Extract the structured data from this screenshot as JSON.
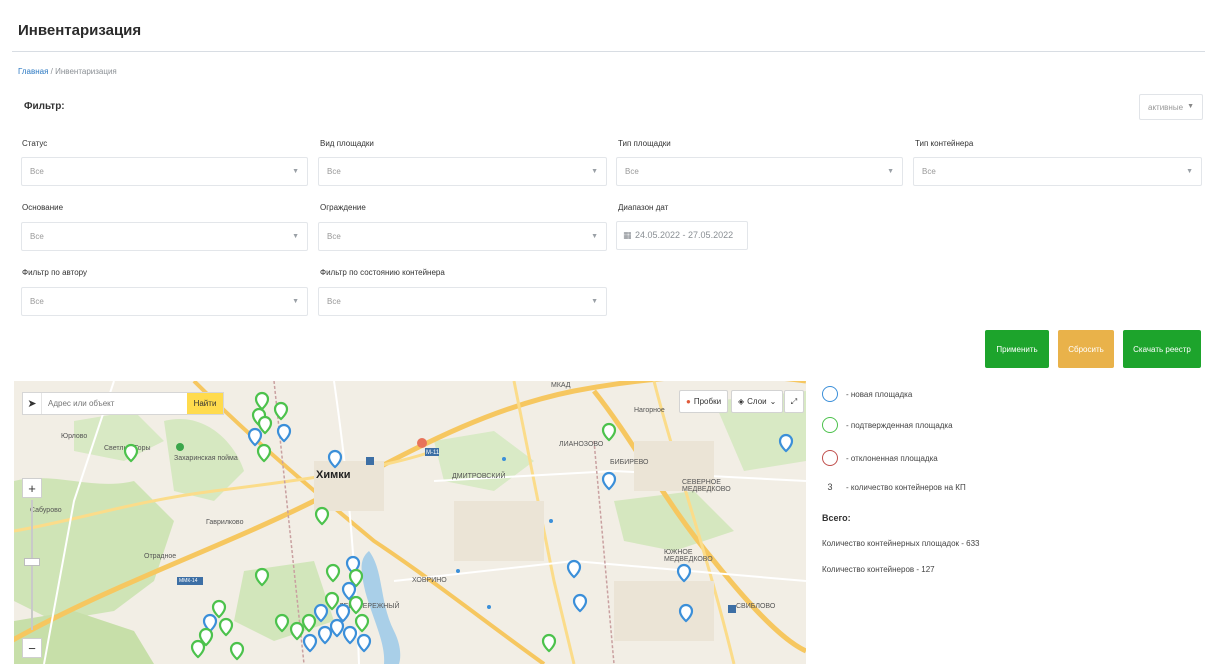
{
  "page": {
    "title": "Инвентаризация",
    "breadcrumb": {
      "home": "Главная",
      "separator": " / ",
      "current": "Инвентаризация"
    }
  },
  "filter": {
    "title": "Фильтр:",
    "active_select": "активные",
    "fields": {
      "status": {
        "label": "Статус",
        "value": "Все"
      },
      "site_kind": {
        "label": "Вид площадки",
        "value": "Все"
      },
      "site_type": {
        "label": "Тип площадки",
        "value": "Все"
      },
      "container_type": {
        "label": "Тип контейнера",
        "value": "Все"
      },
      "base": {
        "label": "Основание",
        "value": "Все"
      },
      "fence": {
        "label": "Ограждение",
        "value": "Все"
      },
      "date_range": {
        "label": "Диапазон дат",
        "value": "24.05.2022 - 27.05.2022"
      },
      "author": {
        "label": "Фильтр по автору",
        "value": "Все"
      },
      "container_state": {
        "label": "Фильтр по состоянию контейнера",
        "value": "Все"
      }
    },
    "buttons": {
      "apply": "Применить",
      "reset": "Сбросить",
      "download": "Скачать реестр"
    }
  },
  "map": {
    "search_placeholder": "Адрес или объект",
    "find_button": "Найти",
    "traffic": "Пробки",
    "layers": "Слои",
    "labels": {
      "khimki": "Химки",
      "yurlovo": "Юрлово",
      "svetlye_gory": "Светлые Горы",
      "zakharinskaya": "Захаринская пойма",
      "saburovo": "Сабурово",
      "gavrilkovo": "Гаврилково",
      "otradnoe": "Отрадное",
      "nagornoe": "Нагорное",
      "dmitrovsky": "ДМИТРОВСКИЙ",
      "severnoe_medvedkovo": "СЕВЕРНОЕ МЕДВЕДКОВО",
      "yuzhnoe_medvedkovo": "ЮЖНОЕ МЕДВЕДКОВО",
      "levoberezhny": "ЛЕВОБЕРЕЖНЫЙ",
      "khovrino": "ХОВРИНО",
      "mkad": "МКАД",
      "m11": "М-11",
      "mm14": "ММК-14",
      "bibirevo": "БИБИРЕВО",
      "sviblovo": "СВИБЛОВО",
      "lianozovo": "ЛИАНОЗОВО"
    },
    "colors": {
      "new": "#3b8fd9",
      "confirmed": "#4cc24c",
      "rejected": "#c0504d"
    }
  },
  "legend": {
    "new": "- новая площадка",
    "confirmed": "- подтвержденная площадка",
    "rejected": "- отклоненная площадка",
    "count_sample": "3",
    "count": "- количество контейнеров на КП"
  },
  "totals": {
    "title": "Всего:",
    "sites": "Количество контейнерных площадок - 633",
    "containers": "Количество контейнеров - 127"
  }
}
